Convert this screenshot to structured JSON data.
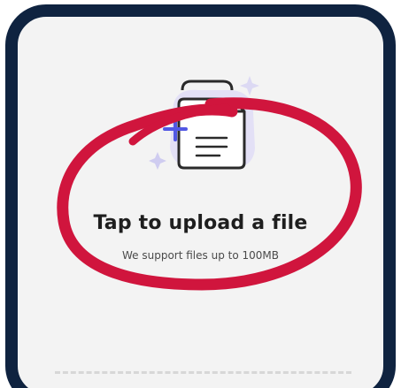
{
  "upload": {
    "title": "Tap to upload a file",
    "subtitle": "We support files up to 100MB"
  },
  "icons": {
    "document": "document-icon",
    "plus": "plus-icon",
    "sparkle": "sparkle-icon"
  },
  "colors": {
    "frame": "#0f2340",
    "panel_background": "#f3f3f3",
    "accent_plus": "#5258e4",
    "annotation_circle": "#d0153d"
  }
}
